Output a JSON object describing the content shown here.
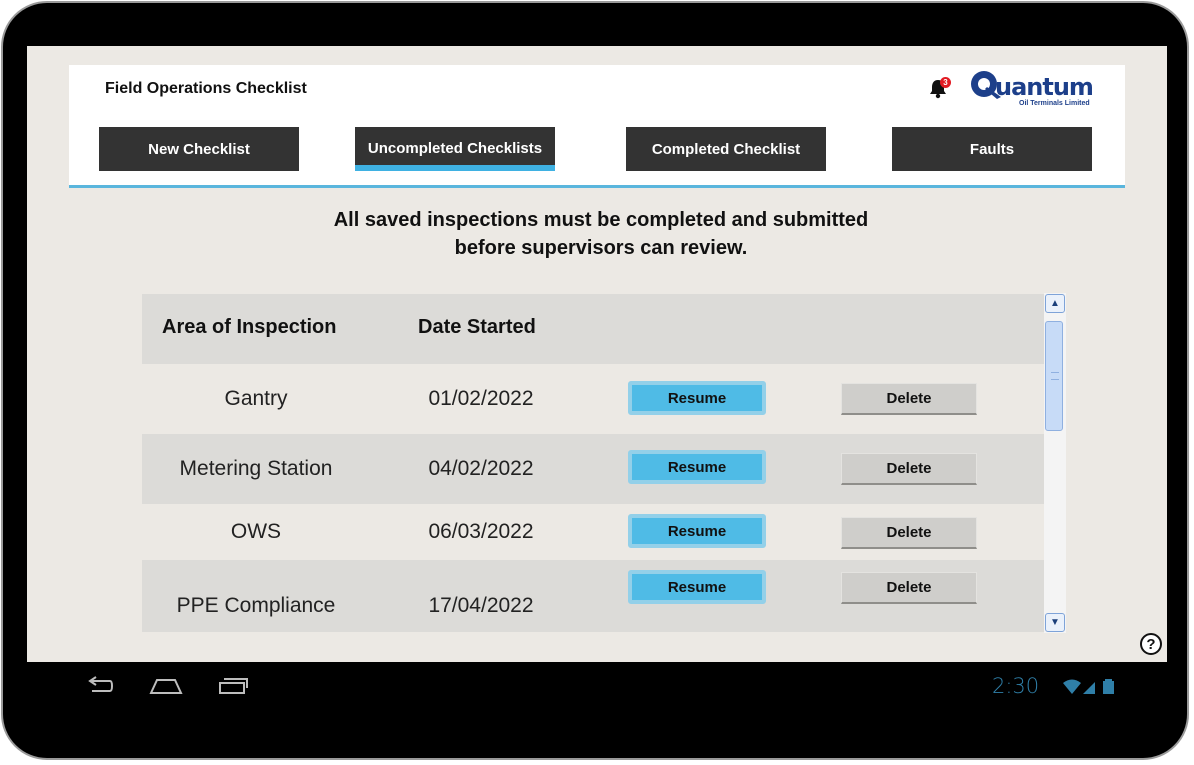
{
  "app": {
    "title": "Field Operations Checklist",
    "notification_count": "3",
    "logo_text": "uantum",
    "logo_subtitle": "Oil Terminals Limited"
  },
  "nav": {
    "tabs": [
      {
        "label": "New Checklist",
        "active": false
      },
      {
        "label": "Uncompleted Checklists",
        "active": true
      },
      {
        "label": "Completed Checklist",
        "active": false
      },
      {
        "label": "Faults",
        "active": false
      }
    ]
  },
  "notice": {
    "line1": "All saved inspections must be completed and submitted",
    "line2": "before supervisors can review."
  },
  "table": {
    "headers": [
      "Area of Inspection",
      "Date Started"
    ],
    "rows": [
      {
        "area": "Gantry",
        "date": "01/02/2022",
        "resume": "Resume",
        "delete": "Delete"
      },
      {
        "area": "Metering Station",
        "date": "04/02/2022",
        "resume": "Resume",
        "delete": "Delete"
      },
      {
        "area": "OWS",
        "date": "06/03/2022",
        "resume": "Resume",
        "delete": "Delete"
      },
      {
        "area": "PPE Compliance",
        "date": "17/04/2022",
        "resume": "Resume",
        "delete": "Delete"
      }
    ]
  },
  "help": {
    "label": "?"
  },
  "system": {
    "time": "2:30"
  },
  "icons": {
    "bell": "bell-icon",
    "help": "question-circle-icon",
    "back": "back-icon",
    "home": "home-icon",
    "recents": "recents-icon",
    "wifi": "wifi-icon",
    "signal": "signal-icon",
    "battery": "battery-icon"
  },
  "colors": {
    "accent": "#3fb1e2",
    "nav_bg": "#333333",
    "screen_bg": "#ece9e4",
    "badge": "#e21b23",
    "clock": "#2f7fa8"
  }
}
